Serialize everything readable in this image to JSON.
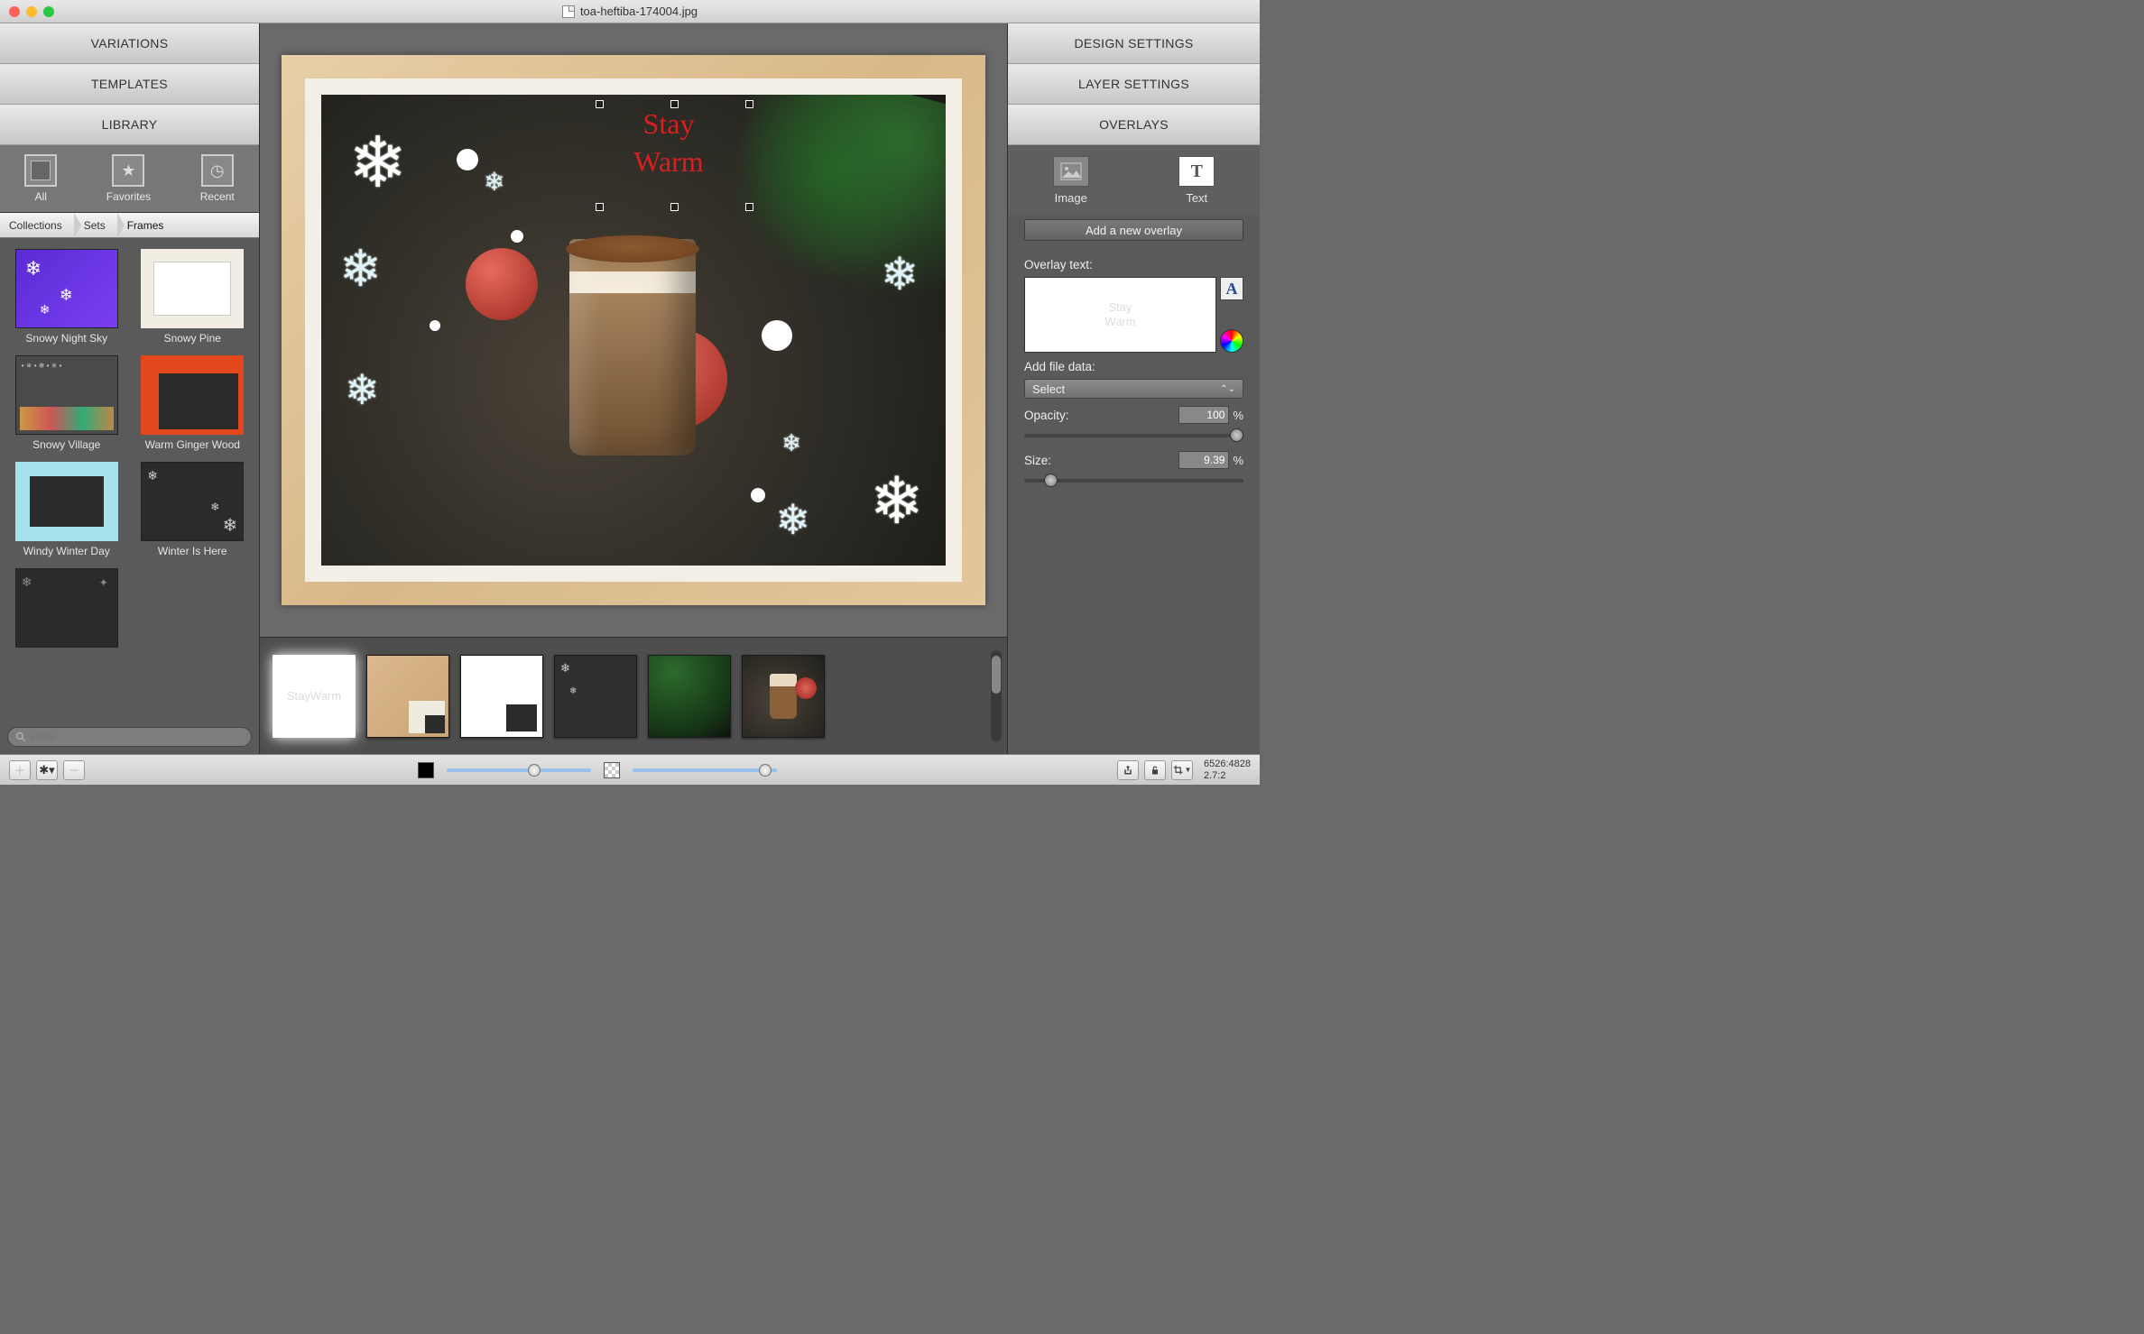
{
  "title": "toa-heftiba-174004.jpg",
  "left": {
    "accordions": [
      "VARIATIONS",
      "TEMPLATES",
      "LIBRARY"
    ],
    "tabs": {
      "all": "All",
      "favorites": "Favorites",
      "recent": "Recent"
    },
    "breadcrumb": [
      "Collections",
      "Sets",
      "Frames"
    ],
    "items": [
      {
        "name": "Snowy Night Sky"
      },
      {
        "name": "Snowy Pine"
      },
      {
        "name": "Snowy Village"
      },
      {
        "name": "Warm Ginger Wood"
      },
      {
        "name": "Windy Winter Day"
      },
      {
        "name": "Winter Is Here"
      }
    ],
    "search_placeholder": "Filter"
  },
  "canvas": {
    "overlay_line1": "Stay",
    "overlay_line2": "Warm"
  },
  "strip": {
    "layer_text": "Stay\nWarm"
  },
  "right": {
    "accordions": [
      "DESIGN SETTINGS",
      "LAYER SETTINGS",
      "OVERLAYS"
    ],
    "tabs": {
      "image": "Image",
      "text": "Text"
    },
    "add_button": "Add a new overlay",
    "overlay_text_label": "Overlay text:",
    "overlay_preview": "Stay\nWarm",
    "add_file_data_label": "Add file data:",
    "select_label": "Select",
    "opacity_label": "Opacity:",
    "opacity_value": "100",
    "opacity_unit": "%",
    "size_label": "Size:",
    "size_value": "9.39",
    "size_unit": "%"
  },
  "footer": {
    "dims": "6526:4828",
    "ratio": "2.7:2"
  }
}
